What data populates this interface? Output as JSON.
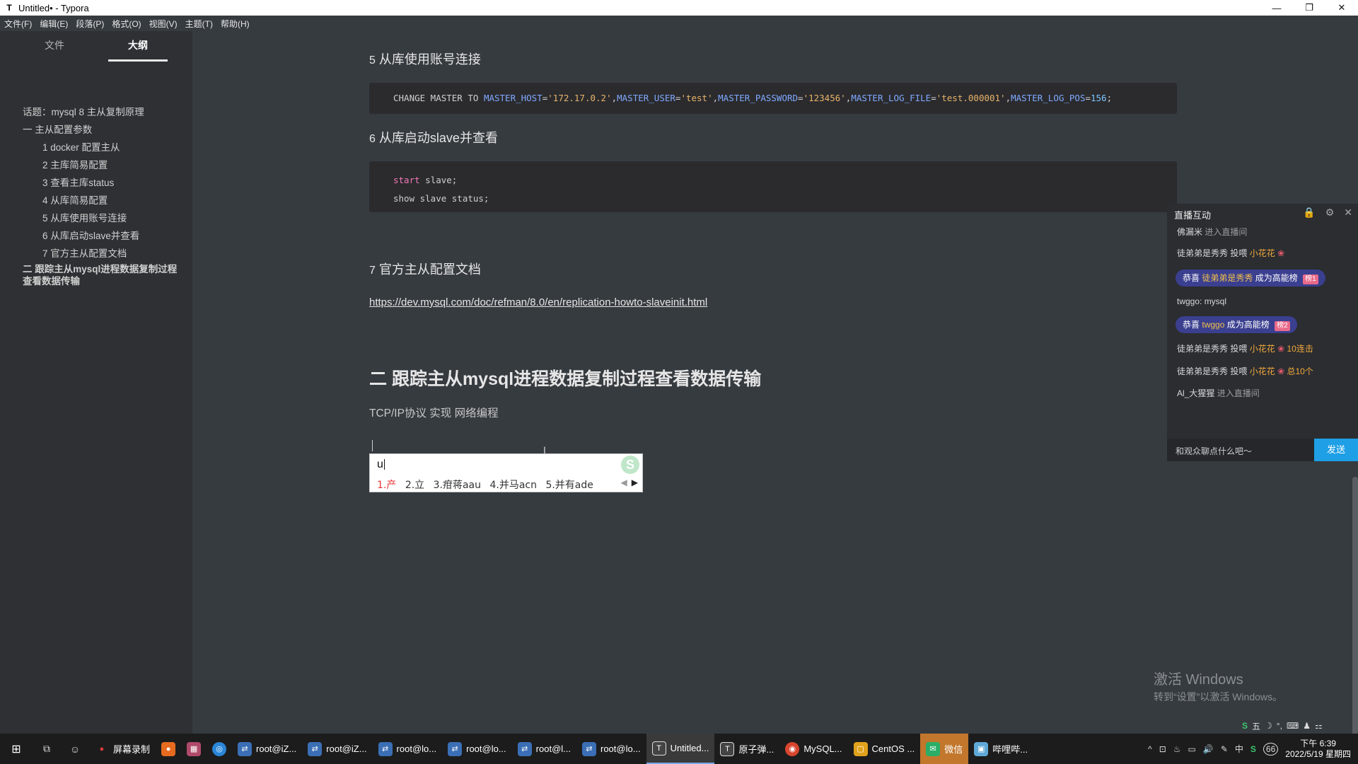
{
  "window": {
    "title": "Untitled• - Typora",
    "controls": {
      "minimize": "—",
      "maximize": "❐",
      "close": "✕"
    }
  },
  "menu": [
    "文件(F)",
    "编辑(E)",
    "段落(P)",
    "格式(O)",
    "视图(V)",
    "主题(T)",
    "帮助(H)"
  ],
  "sidebar": {
    "tabs": [
      {
        "label": "文件",
        "active": false
      },
      {
        "label": "大纲",
        "active": true
      }
    ],
    "outline": [
      {
        "label": "话题：mysql 8 主从复制原理",
        "level": 1
      },
      {
        "label": "一 主从配置参数",
        "level": 1
      },
      {
        "label": "1 docker 配置主从",
        "level": 2
      },
      {
        "label": "2 主库简易配置",
        "level": 2
      },
      {
        "label": "3 查看主库status",
        "level": 2
      },
      {
        "label": "4 从库简易配置",
        "level": 2
      },
      {
        "label": "5 从库使用账号连接",
        "level": 2
      },
      {
        "label": "6 从库启动slave并查看",
        "level": 2
      },
      {
        "label": "7 官方主从配置文档",
        "level": 2
      },
      {
        "label": "二 跟踪主从mysql进程数据复制过程查看数据传输",
        "level": 1
      }
    ],
    "footer": {
      "back": "‹",
      "source": "</>"
    }
  },
  "document": {
    "h5_num": "5",
    "h5_text": "从库使用账号连接",
    "code1": {
      "kw": "CHANGE MASTER TO",
      "parts": [
        {
          "k": "MASTER_HOST",
          "v": "'172.17.0.2'"
        },
        {
          "k": "MASTER_USER",
          "v": "'test'"
        },
        {
          "k": "MASTER_PASSWORD",
          "v": "'123456'"
        },
        {
          "k": "MASTER_LOG_FILE",
          "v": "'test.000001'"
        }
      ],
      "last_k": "MASTER_LOG_POS",
      "last_v": "156"
    },
    "h6_num": "6",
    "h6_text": "从库启动slave并查看",
    "code2": {
      "l1_kw": "start",
      "l1_rest": " slave;",
      "l2": "show slave status;"
    },
    "h7_num": "7",
    "h7_text": "官方主从配置文档",
    "link": "https://dev.mysql.com/doc/refman/8.0/en/replication-howto-slaveinit.html",
    "h2": "二 跟踪主从mysql进程数据复制过程查看数据传输",
    "para": "TCP/IP协议   实现 网络编程"
  },
  "ime": {
    "composition": "u",
    "logo": "S",
    "candidates": [
      "1.产",
      "2.立",
      "3.疳蒋aau",
      "4.并马acn",
      "5.并有ade"
    ]
  },
  "chat": {
    "title": "直播互动",
    "messages": [
      {
        "type": "enter",
        "user": "佛漏米",
        "text": "进入直播间"
      },
      {
        "type": "gift",
        "user": "徒弟弟是秀秀",
        "verb": "投喂",
        "gift": "小花花",
        "extra": ""
      },
      {
        "type": "pill",
        "prefix": "恭喜",
        "user": "徒弟弟是秀秀",
        "text": "成为高能榜",
        "badge": "榜1"
      },
      {
        "type": "text",
        "user": "twggo: mysql"
      },
      {
        "type": "pill",
        "prefix": "恭喜",
        "user": "twggo",
        "text": "成为高能榜",
        "badge": "榜2"
      },
      {
        "type": "gift",
        "user": "徒弟弟是秀秀",
        "verb": "投喂",
        "gift": "小花花",
        "extra": "10连击"
      },
      {
        "type": "gift",
        "user": "徒弟弟是秀秀",
        "verb": "投喂",
        "gift": "小花花",
        "extra": "总10个"
      },
      {
        "type": "enter",
        "user": "Al_大猩猩",
        "text": "进入直播间"
      }
    ],
    "input_placeholder": "和观众聊点什么吧～",
    "send": "发送"
  },
  "watermark": {
    "line1": "激活 Windows",
    "line2": "转到“设置”以激活 Windows。"
  },
  "minitray": [
    "S",
    "五",
    "☽",
    "°,",
    "⌨",
    "♟",
    "⚏"
  ],
  "taskbar": {
    "items": [
      {
        "label": "屏幕录制",
        "icon": "●",
        "color": "#e23a3a"
      },
      {
        "label": "",
        "icon": "🦊",
        "color": "#e66b1f"
      },
      {
        "label": "",
        "icon": "▦",
        "color": "#b04a6a"
      },
      {
        "label": "",
        "icon": "◎",
        "color": "#2a86d8"
      },
      {
        "label": "root@iZ...",
        "icon": "⇄",
        "color": "#3b6fb5"
      },
      {
        "label": "root@iZ...",
        "icon": "⇄",
        "color": "#3b6fb5"
      },
      {
        "label": "root@lo...",
        "icon": "⇄",
        "color": "#3b6fb5"
      },
      {
        "label": "root@lo...",
        "icon": "⇄",
        "color": "#3b6fb5"
      },
      {
        "label": "root@l...",
        "icon": "⇄",
        "color": "#3b6fb5"
      },
      {
        "label": "root@lo...",
        "icon": "⇄",
        "color": "#3b6fb5"
      },
      {
        "label": "Untitled...",
        "icon": "T",
        "color": "#444",
        "active": true
      },
      {
        "label": "原子弹...",
        "icon": "T",
        "color": "#444"
      },
      {
        "label": "MySQL...",
        "icon": "◉",
        "color": "#d8452e"
      },
      {
        "label": "CentOS ...",
        "icon": "▢",
        "color": "#e0a21b"
      },
      {
        "label": "微信",
        "icon": "✉",
        "color": "#2aae67",
        "highlight": true
      },
      {
        "label": "哔哩哔...",
        "icon": "▣",
        "color": "#5fa9d8"
      }
    ],
    "tray_icons": [
      "^",
      "⊡",
      "♨",
      "▭",
      "🔊",
      "✎",
      "中",
      "S",
      "66"
    ],
    "time": "下午 6:39",
    "date": "2022/5/19 星期四"
  }
}
